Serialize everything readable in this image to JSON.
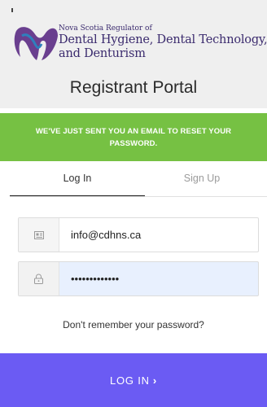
{
  "header": {
    "logo_small": "Nova Scotia Regulator of",
    "logo_line1": "Dental Hygiene, Dental Technology,",
    "logo_line2": "and Denturism",
    "portal_title": "Registrant Portal"
  },
  "banner": {
    "line1": "WE'VE JUST SENT YOU AN EMAIL TO RESET YOUR",
    "line2": "PASSWORD."
  },
  "tabs": {
    "login": "Log In",
    "signup": "Sign Up"
  },
  "form": {
    "email_value": "info@cdhns.ca",
    "email_icon": "id-card-icon",
    "password_value": "•••••••••••••",
    "password_icon": "lock-icon",
    "forgot_label": "Don't remember your password?",
    "submit_label": "LOG IN",
    "submit_chevron": "›"
  },
  "colors": {
    "banner": "#76c143",
    "button": "#6b5bf3",
    "logo": "#3b2b6e"
  }
}
